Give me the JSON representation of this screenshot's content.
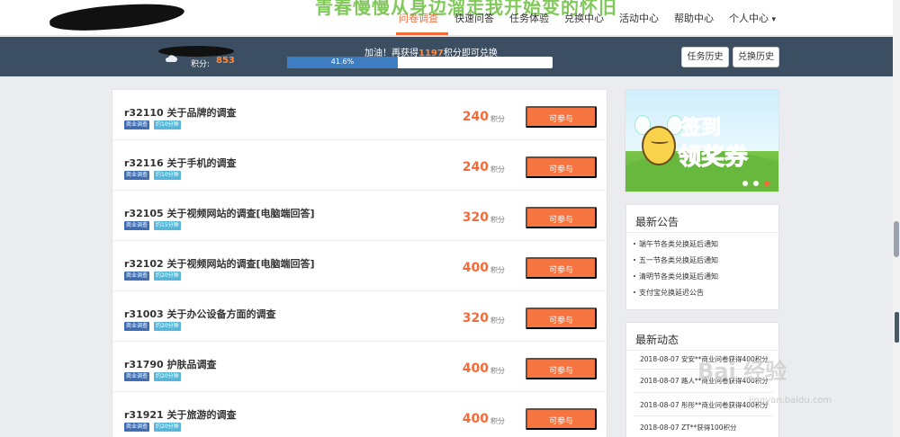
{
  "header": {
    "watermark_title": "青春慢慢从身边溜走我开始变的怀旧",
    "nav": [
      {
        "label": "问卷调查",
        "active": true
      },
      {
        "label": "快速问答"
      },
      {
        "label": "任务体验"
      },
      {
        "label": "兑换中心"
      },
      {
        "label": "活动中心"
      },
      {
        "label": "帮助中心"
      },
      {
        "label": "个人中心"
      }
    ],
    "dropdown_glyph": "▾"
  },
  "status": {
    "points_label": "积分:",
    "points_value": "853",
    "progress_prefix": "加油！再获得",
    "progress_amount": "1197",
    "progress_suffix": "积分即可兑换",
    "progress_percent_text": "41.6%",
    "progress_fraction": 0.416,
    "task_history_label": "任务历史",
    "exchange_history_label": "兑换历史"
  },
  "surveys": [
    {
      "title": "r32110 关于品牌的调查",
      "category": "商业调查",
      "duration": "约10分钟",
      "points": "240",
      "unit": "积分",
      "action": "可参与"
    },
    {
      "title": "r32116 关于手机的调查",
      "category": "商业调查",
      "duration": "约10分钟",
      "points": "240",
      "unit": "积分",
      "action": "可参与"
    },
    {
      "title": "r32105 关于视频网站的调查[电脑端回答]",
      "category": "商业调查",
      "duration": "约15分钟",
      "points": "320",
      "unit": "积分",
      "action": "可参与"
    },
    {
      "title": "r32102 关于视频网站的调查[电脑端回答]",
      "category": "商业调查",
      "duration": "约20分钟",
      "points": "400",
      "unit": "积分",
      "action": "可参与"
    },
    {
      "title": "r31003 关于办公设备方面的调查",
      "category": "商业调查",
      "duration": "约20分钟",
      "points": "320",
      "unit": "积分",
      "action": "可参与"
    },
    {
      "title": "r31790 护肤品调查",
      "category": "商业调查",
      "duration": "约20分钟",
      "points": "400",
      "unit": "积分",
      "action": "可参与"
    },
    {
      "title": "r31921 关于旅游的调查",
      "category": "商业调查",
      "duration": "约20分钟",
      "points": "400",
      "unit": "积分",
      "action": "可参与"
    }
  ],
  "banner": {
    "line1": "签到",
    "line2": "领奖券"
  },
  "notices": {
    "title": "最新公告",
    "items": [
      "端午节各类兑换延后通知",
      "五一节各类兑换延后通知",
      "清明节各类兑换延后通知",
      "支付宝兑换延迟公告"
    ]
  },
  "activity": {
    "title": "最新动态",
    "items": [
      "2018-08-07 安安**商业问卷获得400积分",
      "2018-08-07 路人**商业问卷获得400积分",
      "2018-08-07 彤彤**商业问卷获得400积分",
      "2018-08-07 ZT**获得100积分"
    ]
  },
  "watermark": {
    "brand": "Bai 经验",
    "url": "jingyan.baidu.com"
  },
  "colors": {
    "accent": "#f26b3a",
    "header_bar": "#3c4e61",
    "progress": "#3d7ec3",
    "join_button": "#f5743f"
  }
}
